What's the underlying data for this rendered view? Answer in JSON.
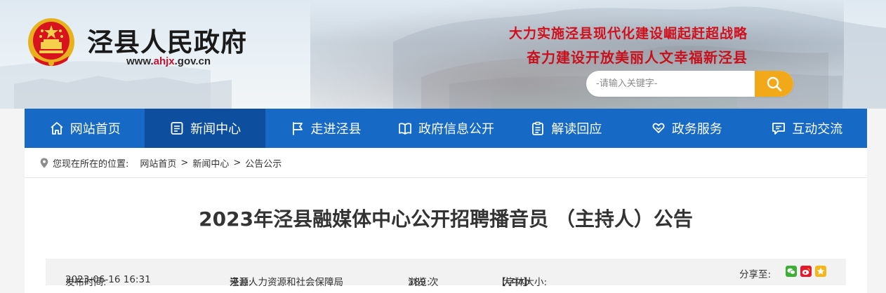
{
  "header": {
    "site_title": "泾县人民政府",
    "url_prefix": "www.",
    "url_highlight": "ahjx",
    "url_suffix": ".gov.cn",
    "slogan_line1": "大力实施泾县现代化建设崛起赶超战略",
    "slogan_line2": "奋力建设开放美丽人文幸福新泾县",
    "search_placeholder": "-请输入关键字-"
  },
  "nav": {
    "items": [
      {
        "label": "网站首页",
        "icon": "home-icon"
      },
      {
        "label": "新闻中心",
        "icon": "news-icon",
        "active": true
      },
      {
        "label": "走进泾县",
        "icon": "flag-icon"
      },
      {
        "label": "政府信息公开",
        "icon": "book-icon"
      },
      {
        "label": "解读回应",
        "icon": "clipboard-icon"
      },
      {
        "label": "政务服务",
        "icon": "heart-hand-icon"
      },
      {
        "label": "互动交流",
        "icon": "chat-icon"
      }
    ]
  },
  "breadcrumb": {
    "prefix": "您现在所在的位置:",
    "items": [
      "网站首页",
      "新闻中心",
      "公告公示"
    ],
    "separator": ">"
  },
  "article": {
    "title": "2023年泾县融媒体中心公开招聘播音员 （主持人）公告",
    "publish_label": "发布时间:",
    "publish_time": "2023-06-16 16:31",
    "source_label": "来源:",
    "source": "泾县人力资源和社会保障局",
    "views_label": "浏览:",
    "views": "189 次",
    "font_size_label": "【字体大小:",
    "font_large": "大",
    "font_medium": "中",
    "font_small": "小",
    "font_size_close": "】",
    "share_label": "分享至:"
  },
  "colors": {
    "nav_bg": "#1669c4",
    "nav_active": "#0d4f9e",
    "slogan_red": "#d0101d",
    "search_button": "#f1a91a",
    "wechat_green": "#3cb034",
    "weibo_red": "#e6162d",
    "qzone_yellow": "#f5b718"
  }
}
